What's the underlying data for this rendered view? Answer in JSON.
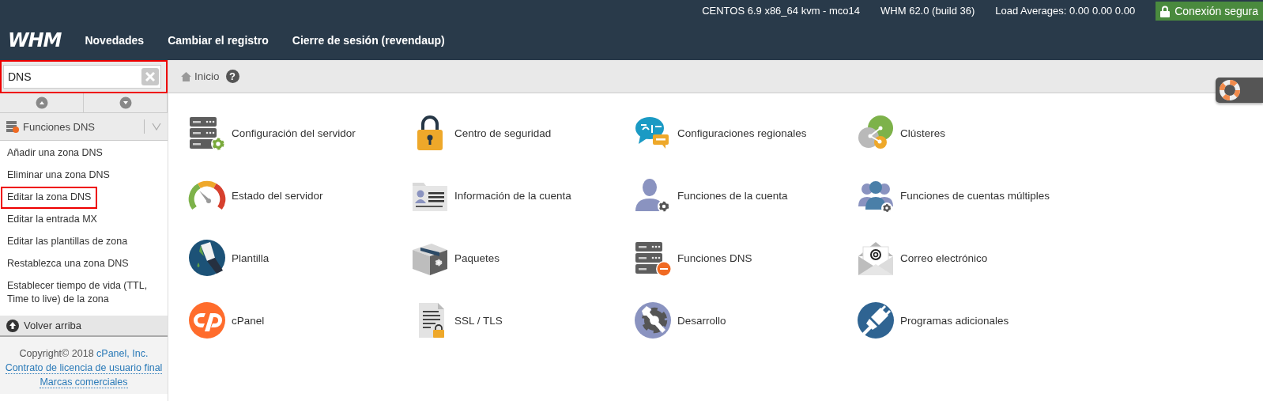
{
  "top_bar": {
    "server": "CENTOS 6.9 x86_64 kvm - mco14",
    "version": "WHM 62.0 (build 36)",
    "load": "Load Averages: 0.00 0.00 0.00",
    "secure_badge": "Conexión segura"
  },
  "nav": {
    "logo": "WHM",
    "items": [
      "Novedades",
      "Cambiar el registro",
      "Cierre de sesión (revendaup)"
    ]
  },
  "sidebar": {
    "search": {
      "value": "DNS",
      "highlighted": true
    },
    "group": {
      "label": "Funciones DNS",
      "expanded": true,
      "items": [
        {
          "label": "Añadir una zona DNS",
          "highlighted": false
        },
        {
          "label": "Eliminar una zona DNS",
          "highlighted": false
        },
        {
          "label": "Editar la zona DNS",
          "highlighted": true
        },
        {
          "label": "Editar la entrada MX",
          "highlighted": false
        },
        {
          "label": "Editar las plantillas de zona",
          "highlighted": false
        },
        {
          "label": "Restablezca una zona DNS",
          "highlighted": false
        },
        {
          "label": "Establecer tiempo de vida (TTL, Time to live) de la zona",
          "highlighted": false
        }
      ]
    },
    "back_to_top": "Volver arriba",
    "footer": {
      "copyright": "Copyright© 2018 ",
      "company": "cPanel, Inc.",
      "links": [
        "Contrato de licencia de usuario final",
        "Marcas comerciales"
      ]
    }
  },
  "breadcrumb": {
    "label": "Inicio",
    "help": "?"
  },
  "tools": [
    {
      "label": "Configuración del servidor",
      "kind": "server-gear"
    },
    {
      "label": "Centro de seguridad",
      "kind": "padlock"
    },
    {
      "label": "Configuraciones regionales",
      "kind": "speech-bubbles"
    },
    {
      "label": "Clústeres",
      "kind": "cluster"
    },
    {
      "label": "Estado del servidor",
      "kind": "gauge"
    },
    {
      "label": "Información de la cuenta",
      "kind": "id-card"
    },
    {
      "label": "Funciones de la cuenta",
      "kind": "person-gear"
    },
    {
      "label": "Funciones de cuentas múltiples",
      "kind": "people-gear"
    },
    {
      "label": "Plantilla",
      "kind": "brush"
    },
    {
      "label": "Paquetes",
      "kind": "box"
    },
    {
      "label": "Funciones DNS",
      "kind": "server-badge"
    },
    {
      "label": "Correo electrónico",
      "kind": "envelope"
    },
    {
      "label": "cPanel",
      "kind": "cpanel"
    },
    {
      "label": "SSL / TLS",
      "kind": "document-lock"
    },
    {
      "label": "Desarrollo",
      "kind": "wrench-gear"
    },
    {
      "label": "Programas adicionales",
      "kind": "plug"
    }
  ]
}
